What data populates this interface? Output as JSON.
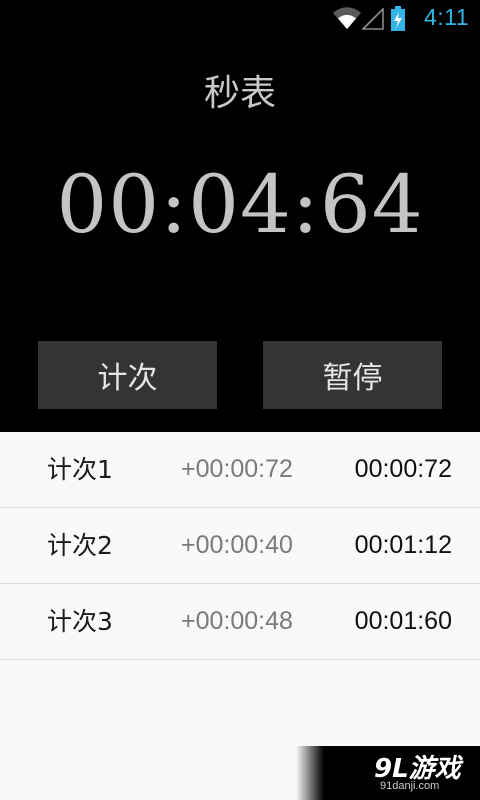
{
  "status_bar": {
    "time": "4:11",
    "icons": [
      "wifi-icon",
      "signal-icon",
      "battery-charging-icon"
    ],
    "accent_color": "#33b5e5"
  },
  "title": "秒表",
  "timer": {
    "display": "00:04:64"
  },
  "buttons": {
    "lap_label": "计次",
    "pause_label": "暂停"
  },
  "laps": [
    {
      "name": "计次1",
      "split": "+00:00:72",
      "total": "00:00:72"
    },
    {
      "name": "计次2",
      "split": "+00:00:40",
      "total": "00:01:12"
    },
    {
      "name": "计次3",
      "split": "+00:00:48",
      "total": "00:01:60"
    }
  ],
  "watermark": {
    "logo": "9L游戏",
    "site": "91danji.com"
  }
}
